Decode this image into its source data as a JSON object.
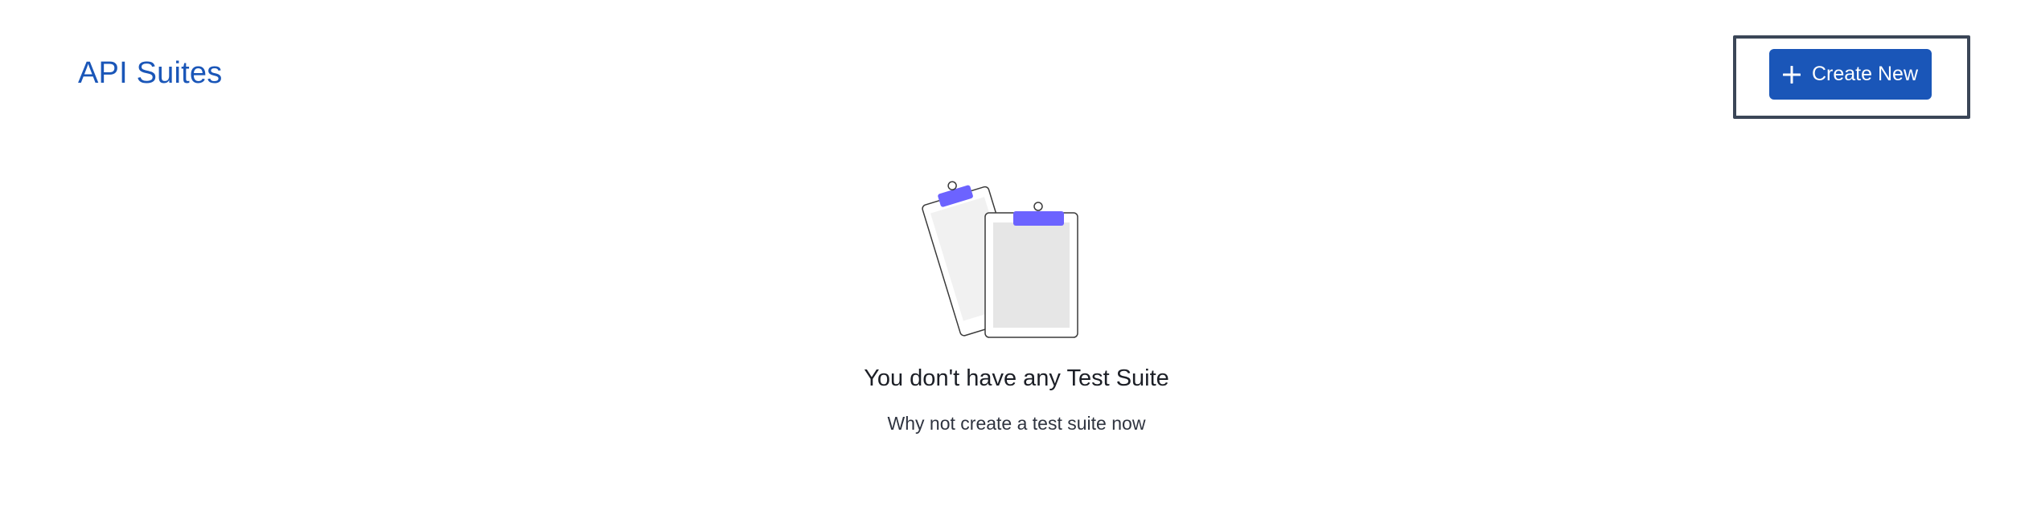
{
  "header": {
    "title": "API Suites",
    "create_button_label": "Create New"
  },
  "icons": {
    "create": "plus-icon",
    "empty_state": "clipboards-illustration"
  },
  "empty_state": {
    "title": "You don't have any Test Suite",
    "subtitle": "Why not create a test suite now"
  },
  "colors": {
    "brand": "#1a56b8",
    "focus_ring": "#3b4657",
    "clip_accent": "#6c63ff"
  }
}
